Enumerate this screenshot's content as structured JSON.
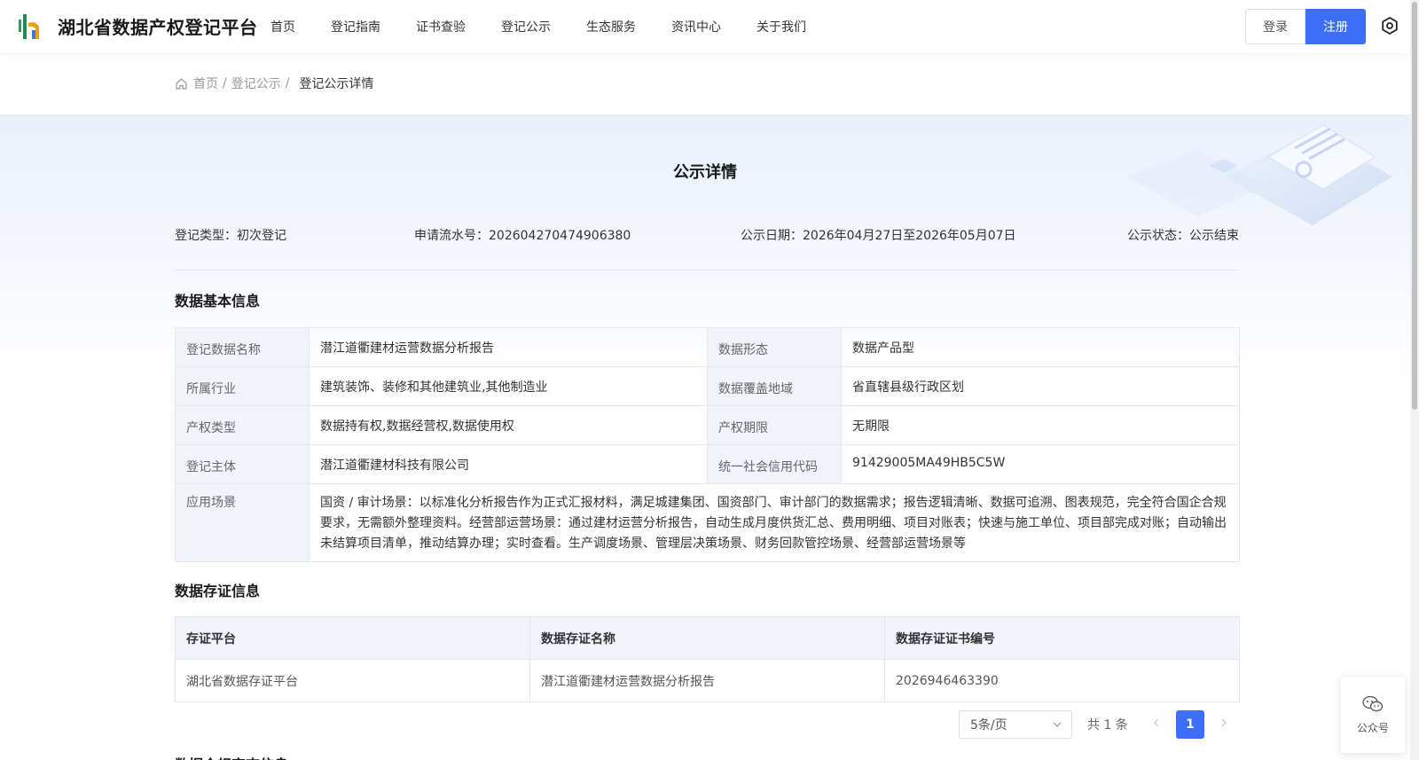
{
  "header": {
    "site_title": "湖北省数据产权登记平台",
    "nav": [
      "首页",
      "登记指南",
      "证书查验",
      "登记公示",
      "生态服务",
      "资讯中心",
      "关于我们"
    ],
    "login_label": "登录",
    "register_label": "注册",
    "accent_color": "#3c6ff5"
  },
  "breadcrumb": {
    "home": "首页",
    "parent": "登记公示",
    "separator": "/",
    "current": "登记公示详情"
  },
  "page_heading": "公示详情",
  "meta": {
    "type": "登记类型：初次登记",
    "serial": "申请流水号：202604270474906380",
    "date": "公示日期：2026年04月27日至2026年05月07日",
    "status": "公示状态：公示结束"
  },
  "basic_info": {
    "title": "数据基本信息",
    "rows": [
      {
        "l1": "登记数据名称",
        "v1": "潜江道衢建材运营数据分析报告",
        "l2": "数据形态",
        "v2": "数据产品型"
      },
      {
        "l1": "所属行业",
        "v1": "建筑装饰、装修和其他建筑业,其他制造业",
        "l2": "数据覆盖地域",
        "v2": "省直辖县级行政区划"
      },
      {
        "l1": "产权类型",
        "v1": "数据持有权,数据经营权,数据使用权",
        "l2": "产权期限",
        "v2": "无期限"
      },
      {
        "l1": "登记主体",
        "v1": "潜江道衢建材科技有限公司",
        "l2": "统一社会信用代码",
        "v2": "91429005MA49HB5C5W"
      }
    ],
    "scene_label": "应用场景",
    "scene_value": "国资 / 审计场景：以标准化分析报告作为正式汇报材料，满足城建集团、国资部门、审计部门的数据需求；报告逻辑清晰、数据可追溯、图表规范，完全符合国企合规要求，无需额外整理资料。经营部运营场景：通过建材运营分析报告，自动生成月度供货汇总、费用明细、项目对账表；快速与施工单位、项目部完成对账；自动输出未结算项目清单，推动结算办理；实时查看。生产调度场景、管理层决策场景、财务回款管控场景、经营部运营场景等"
  },
  "storage_info": {
    "title": "数据存证信息",
    "columns": [
      "存证平台",
      "数据存证名称",
      "数据存证证书编号"
    ],
    "rows": [
      [
        "湖北省数据存证平台",
        "潜江道衢建材运营数据分析报告",
        "2026946463390"
      ]
    ]
  },
  "pagination": {
    "page_size": "5条/页",
    "total": "共 1 条",
    "current_page": "1"
  },
  "next_section_title": "数据合规审查信息",
  "float_widget": {
    "label": "公众号",
    "icon": "wechat-icon"
  }
}
